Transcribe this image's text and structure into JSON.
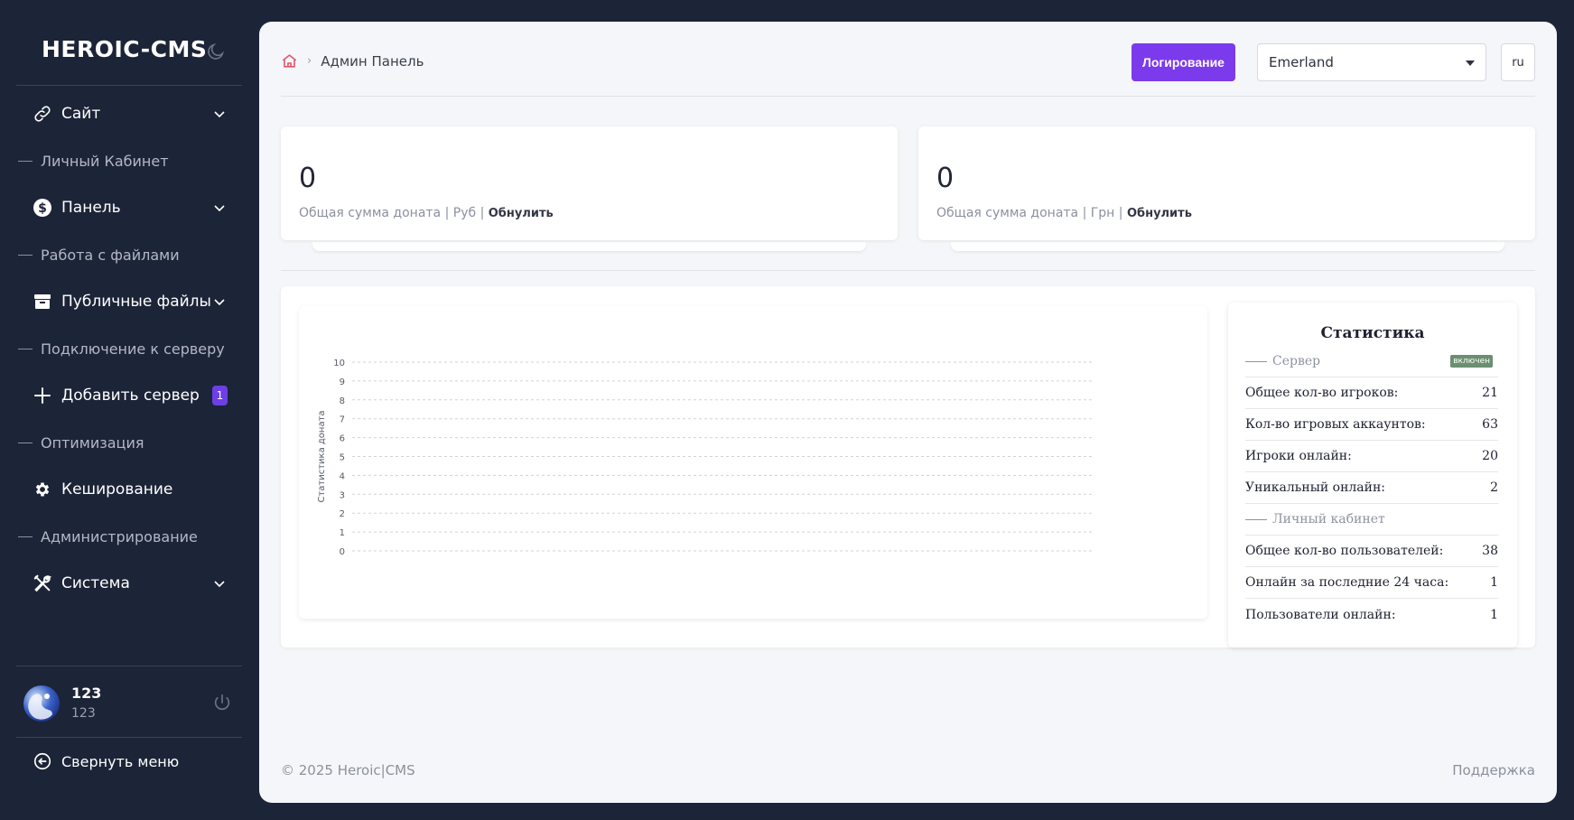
{
  "sidebar": {
    "brand": "HEROIC-CMS",
    "items": [
      {
        "label": "Сайт",
        "icon": "link-icon",
        "type": "dropdown"
      },
      {
        "label": "Личный Кабинет",
        "type": "section"
      },
      {
        "label": "Панель",
        "icon": "dollar-icon",
        "type": "dropdown"
      },
      {
        "label": "Работа с файлами",
        "type": "section"
      },
      {
        "label": "Публичные файлы",
        "icon": "archive-icon",
        "type": "dropdown"
      },
      {
        "label": "Подключение к серверу",
        "type": "section"
      },
      {
        "label": "Добавить сервер",
        "icon": "plus-icon",
        "type": "link",
        "badge": "1"
      },
      {
        "label": "Оптимизация",
        "type": "section"
      },
      {
        "label": "Кеширование",
        "icon": "gear-icon",
        "type": "link"
      },
      {
        "label": "Администрирование",
        "type": "section"
      },
      {
        "label": "Система",
        "icon": "tools-icon",
        "type": "dropdown"
      }
    ],
    "user": {
      "name": "123",
      "sub": "123"
    },
    "collapse_label": "Свернуть меню"
  },
  "header": {
    "breadcrumb": "Админ Панель",
    "log_button": "Логирование",
    "server_selected": "Emerland",
    "lang": "ru"
  },
  "cards": [
    {
      "value": "0",
      "label": "Общая сумма доната | Руб |",
      "action": "Обнулить"
    },
    {
      "value": "0",
      "label": "Общая сумма доната | Грн |",
      "action": "Обнулить"
    }
  ],
  "chart_data": {
    "type": "line",
    "ylabel": "Статистика доната",
    "ylim": [
      0,
      10
    ],
    "yticks": [
      "0",
      "1",
      "2",
      "3",
      "4",
      "5",
      "6",
      "7",
      "8",
      "9",
      "10"
    ],
    "grid": true
  },
  "stats": {
    "title": "Статистика",
    "server_section": "Сервер",
    "server_status": "включен",
    "server_rows": [
      {
        "k": "Общее кол-во игроков:",
        "v": "21"
      },
      {
        "k": "Кол-во игровых аккаунтов:",
        "v": "63"
      },
      {
        "k": "Игроки онлайн:",
        "v": "20"
      },
      {
        "k": "Уникальный онлайн:",
        "v": "2"
      }
    ],
    "cabinet_section": "Личный кабинет",
    "cabinet_rows": [
      {
        "k": "Общее кол-во пользователей:",
        "v": "38"
      },
      {
        "k": "Онлайн за последние 24 часа:",
        "v": "1"
      },
      {
        "k": "Пользователи онлайн:",
        "v": "1"
      }
    ]
  },
  "footer": {
    "copyright": "© 2025 Heroic|CMS",
    "support": "Поддержка"
  }
}
